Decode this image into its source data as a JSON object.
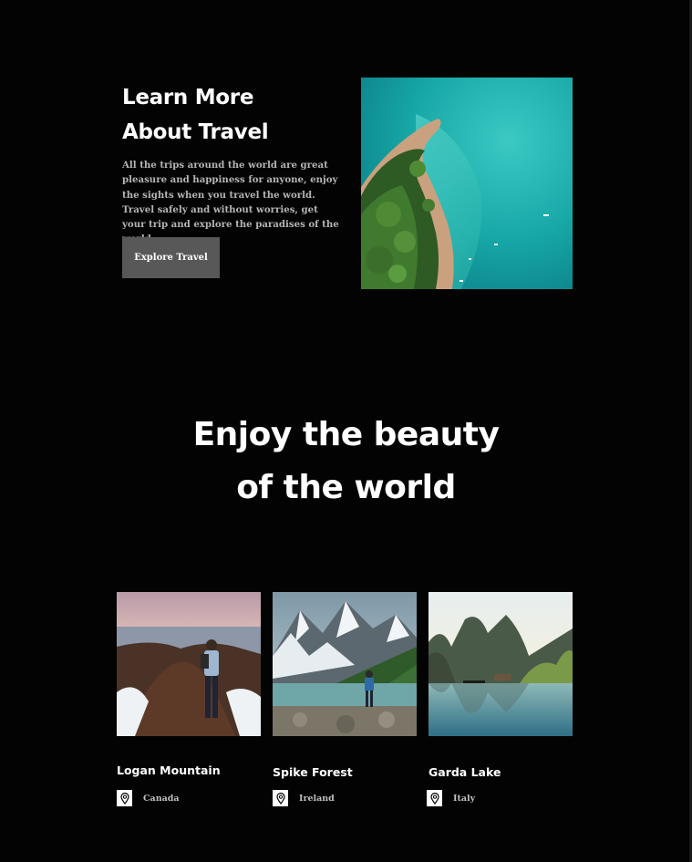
{
  "about": {
    "title_line1": "Learn More",
    "title_line2": "About Travel",
    "description": "All  the trips around the world are great pleasure and happiness for anyone, enjoy the sights when you travel the world. Travel safely and without worries, get your trip and explore the paradises of the world.",
    "button_label": "Explore Travel"
  },
  "section": {
    "title_line1": "Enjoy the beauty",
    "title_line2": "of the world"
  },
  "destinations": [
    {
      "name": "Logan Mountain",
      "location": "Canada",
      "icon": "map-pin-icon"
    },
    {
      "name": "Spike Forest",
      "location": "Ireland",
      "icon": "map-pin-icon"
    },
    {
      "name": "Garda Lake",
      "location": "Italy",
      "icon": "map-pin-icon"
    }
  ],
  "colors": {
    "background": "#030303",
    "button_bg": "#585858",
    "description_text": "#b4b4b4",
    "text": "#ffffff"
  }
}
